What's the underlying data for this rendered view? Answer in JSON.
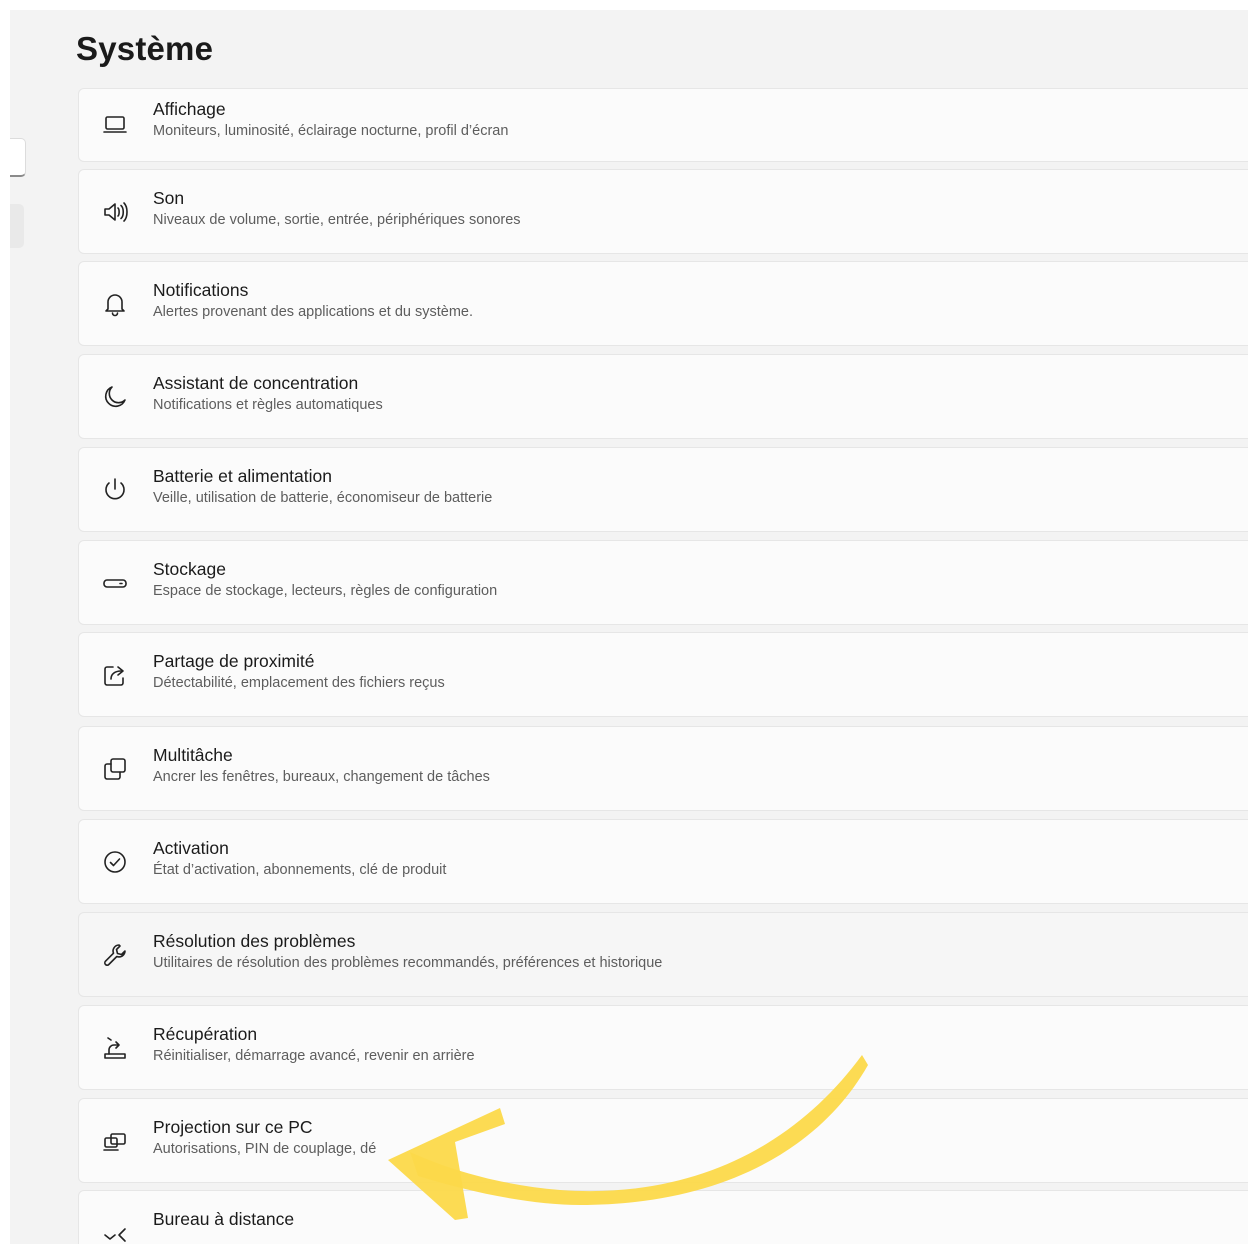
{
  "page": {
    "title": "Système"
  },
  "settings": [
    {
      "label": "Affichage",
      "description": "Moniteurs, luminosité, éclairage nocturne, profil d’écran",
      "icon": "monitor-icon"
    },
    {
      "label": "Son",
      "description": "Niveaux de volume, sortie, entrée, périphériques sonores",
      "icon": "speaker-icon"
    },
    {
      "label": "Notifications",
      "description": "Alertes provenant des applications et du système.",
      "icon": "bell-icon"
    },
    {
      "label": "Assistant de concentration",
      "description": "Notifications et règles automatiques",
      "icon": "moon-icon"
    },
    {
      "label": "Batterie et alimentation",
      "description": "Veille, utilisation de batterie, économiseur de batterie",
      "icon": "power-icon"
    },
    {
      "label": "Stockage",
      "description": "Espace de stockage, lecteurs, règles de configuration",
      "icon": "storage-drive-icon"
    },
    {
      "label": "Partage de proximité",
      "description": "Détectabilité, emplacement des fichiers reçus",
      "icon": "share-icon"
    },
    {
      "label": "Multitâche",
      "description": "Ancrer les fenêtres, bureaux, changement de tâches",
      "icon": "multitask-windows-icon"
    },
    {
      "label": "Activation",
      "description": "État d’activation, abonnements, clé de produit",
      "icon": "checkmark-circle-icon"
    },
    {
      "label": "Résolution des problèmes",
      "description": "Utilitaires de résolution des problèmes recommandés, préférences et historique",
      "icon": "wrench-icon"
    },
    {
      "label": "Récupération",
      "description": "Réinitialiser, démarrage avancé, revenir en arrière",
      "icon": "recovery-icon"
    },
    {
      "label": "Projection sur ce PC",
      "description": "Autorisations, PIN de couplage, dé",
      "icon": "projection-icon"
    },
    {
      "label": "Bureau à distance",
      "description": "",
      "icon": "remote-desktop-icon"
    }
  ],
  "annotation": {
    "color": "#fcd94a",
    "icon": "curved-arrow-annotation"
  }
}
